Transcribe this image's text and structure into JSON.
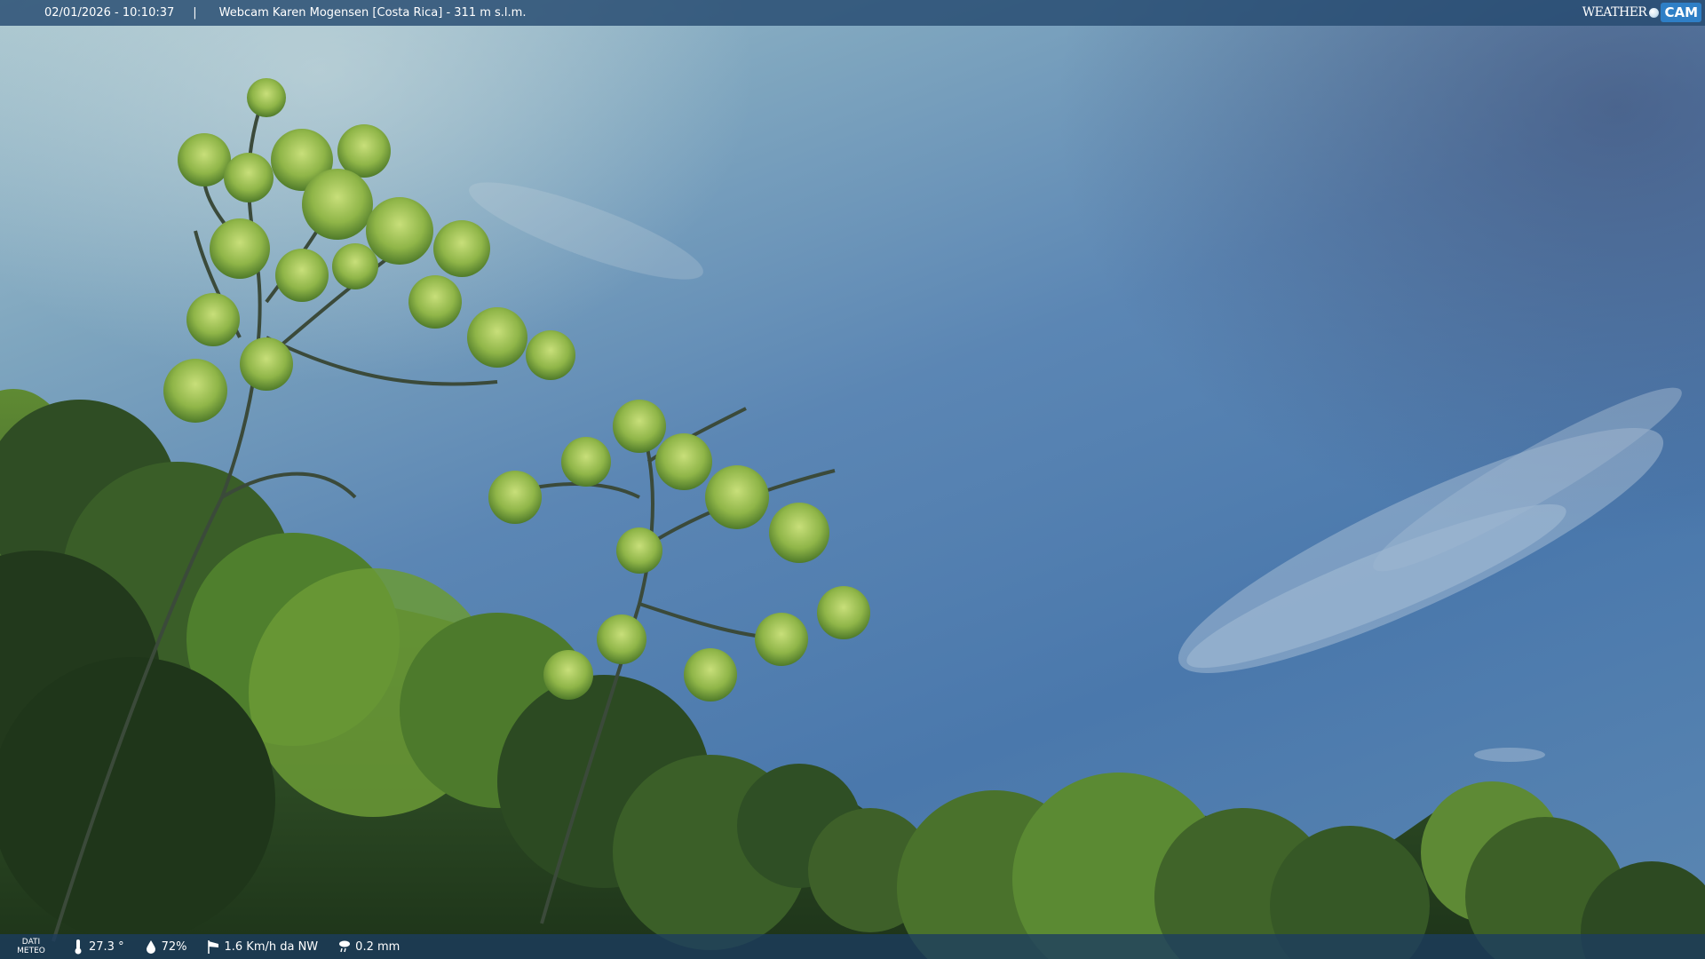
{
  "header": {
    "datetime": "02/01/2026 - 10:10:37",
    "separator": "|",
    "title": "Webcam Karen Mogensen [Costa Rica] - 311 m s.l.m.",
    "logo_weather": "WEATHER",
    "logo_cam": "CAM"
  },
  "weather": {
    "label_line1": "DATI",
    "label_line2": "METEO",
    "temperature": "27.3 °",
    "humidity": "72%",
    "wind": "1.6 Km/h da NW",
    "rain": "0.2 mm"
  },
  "icons": {
    "temperature": "thermometer-icon",
    "humidity": "humidity-drop-icon",
    "wind": "windsock-icon",
    "rain": "rain-cloud-icon"
  },
  "colors": {
    "bar": "#264a70",
    "logo_accent": "#2f7fc6",
    "foliage_dark": "#1e3a1c",
    "foliage_mid": "#4e7a2a",
    "foliage_light": "#9fc44a"
  }
}
